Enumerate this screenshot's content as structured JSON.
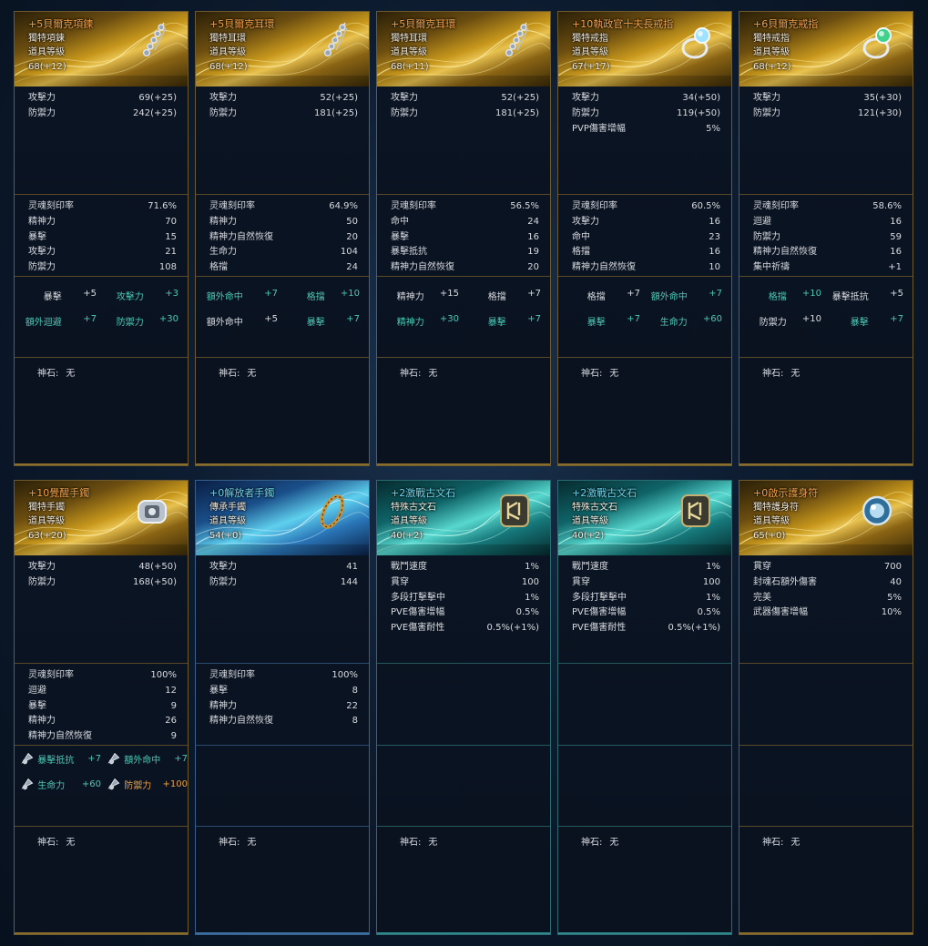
{
  "cards": [
    {
      "theme": "gold",
      "name": "+5貝爾克項鍊",
      "type": "獨特項鍊",
      "level_label": "道具等級",
      "level": "68(+12)",
      "base": [
        [
          "攻擊力",
          "69(+25)"
        ],
        [
          "防禦力",
          "242(+25)"
        ]
      ],
      "soul": [
        [
          "灵魂刻印率",
          "71.6%"
        ],
        [
          "精神力",
          "70"
        ],
        [
          "暴擊",
          "15"
        ],
        [
          "攻擊力",
          "21"
        ],
        [
          "防禦力",
          "108"
        ]
      ],
      "random": [
        [
          {
            "l": "暴擊",
            "v": "+5",
            "c": "w"
          },
          {
            "l": "攻擊力",
            "v": "+3",
            "c": "c"
          }
        ],
        [
          {
            "l": "額外迴避",
            "v": "+7",
            "c": "c"
          },
          {
            "l": "防禦力",
            "v": "+30",
            "c": "c"
          }
        ]
      ],
      "god_label": "神石:",
      "god_value": "无"
    },
    {
      "theme": "gold",
      "name": "+5貝爾克耳環",
      "type": "獨特耳環",
      "level_label": "道具等級",
      "level": "68(+12)",
      "base": [
        [
          "攻擊力",
          "52(+25)"
        ],
        [
          "防禦力",
          "181(+25)"
        ]
      ],
      "soul": [
        [
          "灵魂刻印率",
          "64.9%"
        ],
        [
          "精神力",
          "50"
        ],
        [
          "精神力自然恢復",
          "20"
        ],
        [
          "生命力",
          "104"
        ],
        [
          "格擋",
          "24"
        ]
      ],
      "random": [
        [
          {
            "l": "額外命中",
            "v": "+7",
            "c": "c"
          },
          {
            "l": "格擋",
            "v": "+10",
            "c": "c"
          }
        ],
        [
          {
            "l": "額外命中",
            "v": "+5",
            "c": "w"
          },
          {
            "l": "暴擊",
            "v": "+7",
            "c": "c"
          }
        ]
      ],
      "god_label": "神石:",
      "god_value": "无"
    },
    {
      "theme": "gold",
      "name": "+5貝爾克耳環",
      "type": "獨特耳環",
      "level_label": "道具等級",
      "level": "68(+11)",
      "base": [
        [
          "攻擊力",
          "52(+25)"
        ],
        [
          "防禦力",
          "181(+25)"
        ]
      ],
      "soul": [
        [
          "灵魂刻印率",
          "56.5%"
        ],
        [
          "命中",
          "24"
        ],
        [
          "暴擊",
          "16"
        ],
        [
          "暴擊抵抗",
          "19"
        ],
        [
          "精神力自然恢復",
          "20"
        ]
      ],
      "random": [
        [
          {
            "l": "精神力",
            "v": "+15",
            "c": "w"
          },
          {
            "l": "格擋",
            "v": "+7",
            "c": "w"
          }
        ],
        [
          {
            "l": "精神力",
            "v": "+30",
            "c": "c"
          },
          {
            "l": "暴擊",
            "v": "+7",
            "c": "c"
          }
        ]
      ],
      "god_label": "神石:",
      "god_value": "无"
    },
    {
      "theme": "gold",
      "name": "+10執政官十夫長戒指",
      "type": "獨特戒指",
      "level_label": "道具等級",
      "level": "67(+17)",
      "base": [
        [
          "攻擊力",
          "34(+50)"
        ],
        [
          "防禦力",
          "119(+50)"
        ],
        [
          "PVP傷害增幅",
          "5%"
        ]
      ],
      "soul": [
        [
          "灵魂刻印率",
          "60.5%"
        ],
        [
          "攻擊力",
          "16"
        ],
        [
          "命中",
          "23"
        ],
        [
          "格擋",
          "16"
        ],
        [
          "精神力自然恢復",
          "10"
        ]
      ],
      "random": [
        [
          {
            "l": "格擋",
            "v": "+7",
            "c": "w"
          },
          {
            "l": "額外命中",
            "v": "+7",
            "c": "c"
          }
        ],
        [
          {
            "l": "暴擊",
            "v": "+7",
            "c": "c"
          },
          {
            "l": "生命力",
            "v": "+60",
            "c": "c"
          }
        ]
      ],
      "god_label": "神石:",
      "god_value": "无"
    },
    {
      "theme": "gold",
      "name": "+6貝爾克戒指",
      "type": "獨特戒指",
      "level_label": "道具等級",
      "level": "68(+12)",
      "base": [
        [
          "攻擊力",
          "35(+30)"
        ],
        [
          "防禦力",
          "121(+30)"
        ]
      ],
      "soul": [
        [
          "灵魂刻印率",
          "58.6%"
        ],
        [
          "迴避",
          "16"
        ],
        [
          "防禦力",
          "59"
        ],
        [
          "精神力自然恢復",
          "16"
        ],
        [
          "集中祈禱",
          "+1"
        ]
      ],
      "random": [
        [
          {
            "l": "格擋",
            "v": "+10",
            "c": "c"
          },
          {
            "l": "暴擊抵抗",
            "v": "+5",
            "c": "w"
          }
        ],
        [
          {
            "l": "防禦力",
            "v": "+10",
            "c": "w"
          },
          {
            "l": "暴擊",
            "v": "+7",
            "c": "c"
          }
        ]
      ],
      "god_label": "神石:",
      "god_value": "无"
    },
    {
      "theme": "gold",
      "name": "+10覺醒手鐲",
      "type": "獨特手鐲",
      "level_label": "道具等級",
      "level": "63(+20)",
      "base": [
        [
          "攻擊力",
          "48(+50)"
        ],
        [
          "防禦力",
          "168(+50)"
        ]
      ],
      "soul": [
        [
          "灵魂刻印率",
          "100%"
        ],
        [
          "迴避",
          "12"
        ],
        [
          "暴擊",
          "9"
        ],
        [
          "精神力",
          "26"
        ],
        [
          "精神力自然恢復",
          "9"
        ]
      ],
      "gems": [
        [
          {
            "l": "暴擊抵抗",
            "v": "+7",
            "c": "c"
          },
          {
            "l": "額外命中",
            "v": "+7",
            "c": "c"
          }
        ],
        [
          {
            "l": "生命力",
            "v": "+60",
            "c": "c"
          },
          {
            "l": "防禦力",
            "v": "+100",
            "c": "o"
          }
        ]
      ],
      "god_label": "神石:",
      "god_value": "无"
    },
    {
      "theme": "blue",
      "name": "+0解放者手鐲",
      "type": "傳承手鐲",
      "level_label": "道具等級",
      "level": "54(+0)",
      "base": [
        [
          "攻擊力",
          "41"
        ],
        [
          "防禦力",
          "144"
        ]
      ],
      "soul": [
        [
          "灵魂刻印率",
          "100%"
        ],
        [
          "暴擊",
          "8"
        ],
        [
          "精神力",
          "22"
        ],
        [
          "精神力自然恢復",
          "8"
        ]
      ],
      "god_label": "神石:",
      "god_value": "无"
    },
    {
      "theme": "teal",
      "name": "+2激戰古文石",
      "type": "特殊古文石",
      "level_label": "道具等級",
      "level": "40(+2)",
      "base": [
        [
          "戰鬥速度",
          "1%"
        ],
        [
          "貫穿",
          "100"
        ],
        [
          "多段打擊擊中",
          "1%"
        ],
        [
          "PVE傷害增幅",
          "0.5%"
        ],
        [
          "PVE傷害耐性",
          "0.5%(+1%)"
        ]
      ],
      "god_label": "神石:",
      "god_value": "无"
    },
    {
      "theme": "teal",
      "name": "+2激戰古文石",
      "type": "特殊古文石",
      "level_label": "道具等級",
      "level": "40(+2)",
      "base": [
        [
          "戰鬥速度",
          "1%"
        ],
        [
          "貫穿",
          "100"
        ],
        [
          "多段打擊擊中",
          "1%"
        ],
        [
          "PVE傷害增幅",
          "0.5%"
        ],
        [
          "PVE傷害耐性",
          "0.5%(+1%)"
        ]
      ],
      "god_label": "神石:",
      "god_value": "无"
    },
    {
      "theme": "gold",
      "name": "+0啟示護身符",
      "type": "獨特護身符",
      "level_label": "道具等級",
      "level": "65(+0)",
      "base": [
        [
          "貫穿",
          "700"
        ],
        [
          "封魂石額外傷害",
          "40"
        ],
        [
          "完美",
          "5%"
        ],
        [
          "武器傷害增幅",
          "10%"
        ]
      ],
      "god_label": "神石:",
      "god_value": "无"
    }
  ]
}
